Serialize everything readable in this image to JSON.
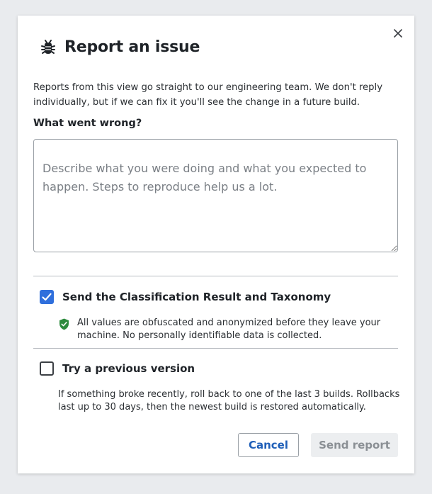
{
  "dialog": {
    "title": "Report an issue",
    "intro": "Reports from this view go straight to our engineering team. We don't reply individually, but if we can fix it you'll see the change in a future build.",
    "field_label": "What went wrong?",
    "textarea_placeholder": "Describe what you were doing and what you expected to happen. Steps to reproduce help us a lot.",
    "textarea_value": "",
    "option_send": {
      "label": "Send the Classification Result and Taxonomy",
      "checked": true,
      "note": "All values are obfuscated and anonymized before they leave your machine. No personally identifiable data is collected."
    },
    "option_rollback": {
      "label": "Try a previous version",
      "checked": false,
      "note": "If something broke recently, roll back to one of the last 3 builds. Rollbacks last up to 30 days, then the newest build is restored automatically."
    },
    "cancel_label": "Cancel",
    "send_label": "Send report"
  },
  "icons": {
    "close": "close-icon",
    "bug": "bug-icon",
    "check": "check-icon",
    "shield": "shield-check-icon"
  },
  "colors": {
    "accent": "#2f6fdc",
    "link": "#1f5fb8",
    "shield": "#2e8b3e",
    "disabled_bg": "#eceef0",
    "disabled_text": "#8a8f94"
  }
}
